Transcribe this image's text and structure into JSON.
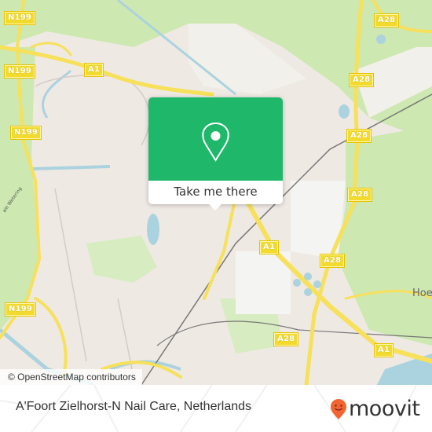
{
  "map": {
    "road_labels": [
      {
        "id": "n199-top",
        "text": "N199"
      },
      {
        "id": "a1-top",
        "text": "A1"
      },
      {
        "id": "n199-mid",
        "text": "N199"
      },
      {
        "id": "n199-lower",
        "text": "N199"
      },
      {
        "id": "a28-top",
        "text": "A28"
      },
      {
        "id": "a28-upper",
        "text": "A28"
      },
      {
        "id": "a28-mid",
        "text": "A28"
      },
      {
        "id": "a28-right",
        "text": "A28"
      },
      {
        "id": "a1-center",
        "text": "A1"
      },
      {
        "id": "a28-center",
        "text": "A28"
      },
      {
        "id": "n199-bottom",
        "text": "N199"
      },
      {
        "id": "a28-bottom",
        "text": "A28"
      },
      {
        "id": "a1-bottom",
        "text": "A1"
      }
    ],
    "place_labels": [
      {
        "id": "hoe",
        "text": "Hoe"
      }
    ],
    "water_labels": [
      {
        "id": "wetering",
        "text": "ale Wetering"
      }
    ],
    "attribution": "© OpenStreetMap contributors",
    "colors": {
      "urban": "#efe9e4",
      "green": "#cde8b0",
      "water": "#aad3df",
      "highway": "#f7e05a",
      "rail": "#777777"
    }
  },
  "popup": {
    "icon": "map-pin-icon",
    "cta_label": "Take me there",
    "accent": "#1fb86a"
  },
  "footer": {
    "place_name": "A'Foort Zielhorst-N Nail Care, Netherlands",
    "brand_icon": "moovit-logo-icon",
    "brand_name": "moovit",
    "brand_color": "#f26430"
  }
}
